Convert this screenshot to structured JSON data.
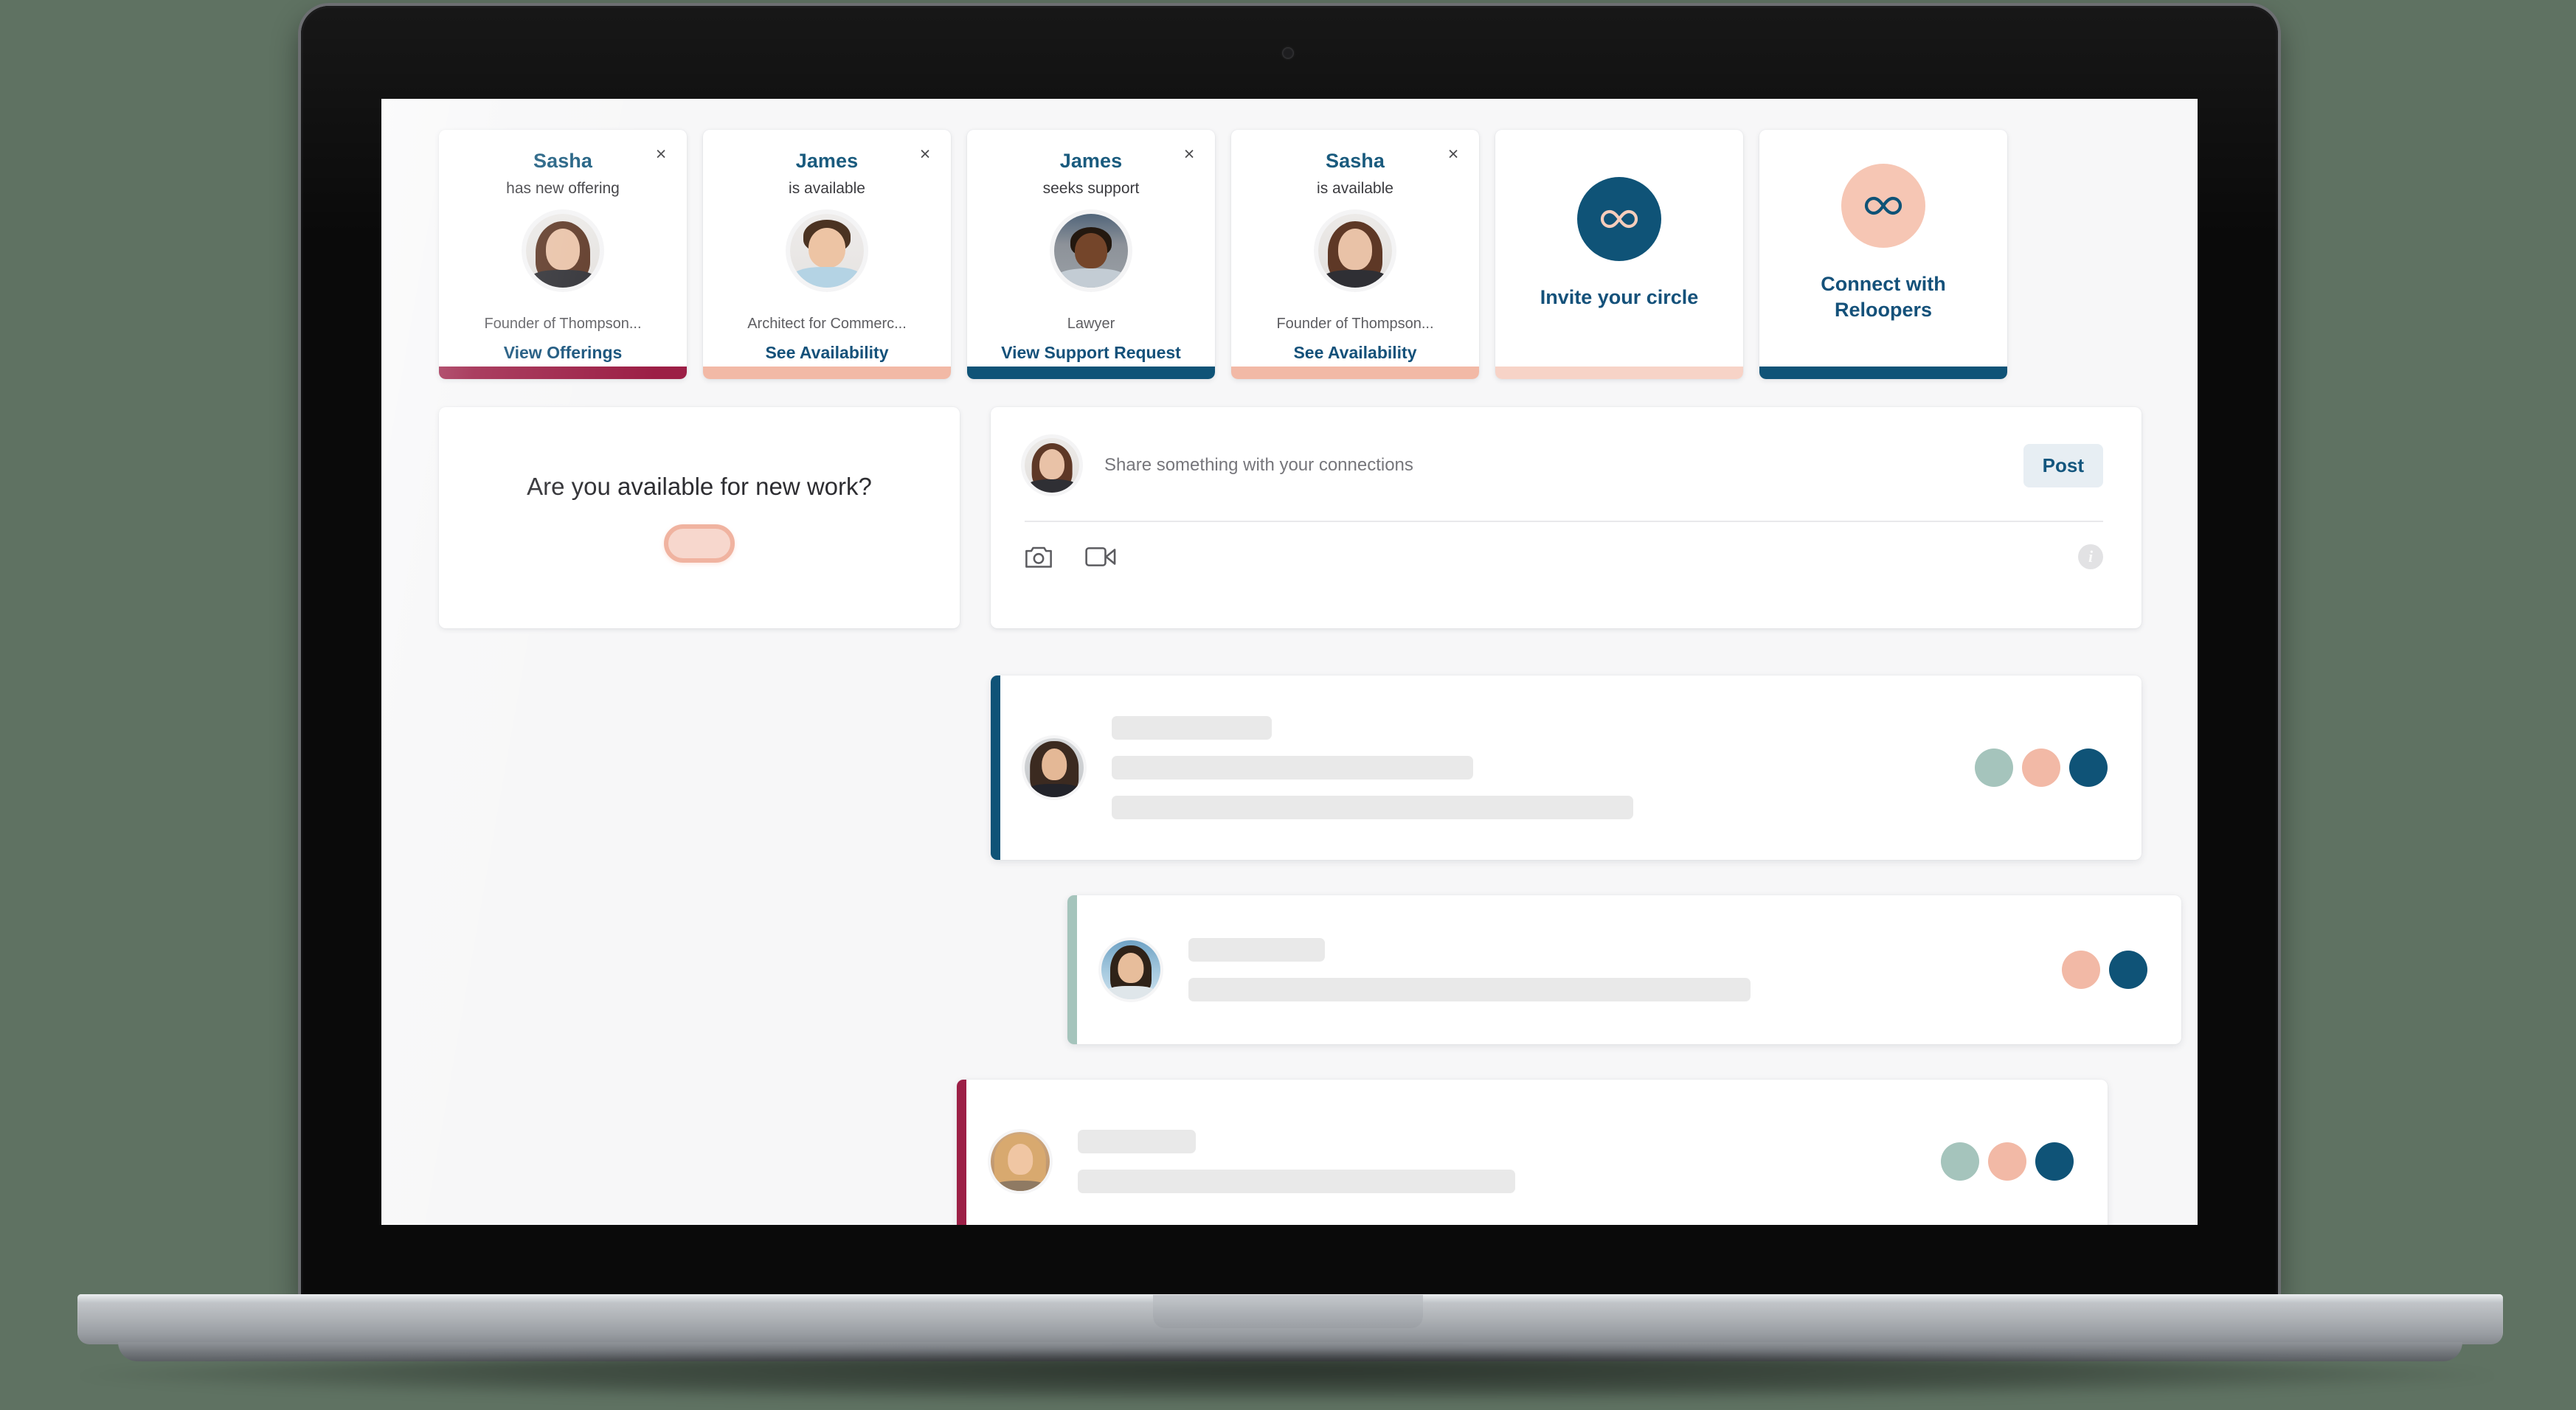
{
  "colors": {
    "navy": "#0f5377",
    "navy_text": "#14517a",
    "burgundy": "#9c1f46",
    "salmon": "#f2b9a6",
    "sage": "#a5c4bc",
    "screen_bg": "#f7f7f8",
    "post_button_bg": "#e7eef3",
    "toggle_fill": "#f7d7cd",
    "toggle_border": "#f0b3a0"
  },
  "notifications": [
    {
      "name": "Sasha",
      "status": "has new offering",
      "role": "Founder of Thompson...",
      "action": "View Offerings",
      "accent": "#9c1f46",
      "close_icon": "close-icon",
      "avatar": "av-sasha"
    },
    {
      "name": "James",
      "status": "is available",
      "role": "Architect for Commerc...",
      "action": "See Availability",
      "accent": "#f2b9a6",
      "close_icon": "close-icon",
      "avatar": "av-james"
    },
    {
      "name": "James",
      "status": "seeks support",
      "role": "Lawyer",
      "action": "View Support Request",
      "accent": "#0f5377",
      "close_icon": "close-icon",
      "avatar": "av-lawyer"
    },
    {
      "name": "Sasha",
      "status": "is available",
      "role": "Founder of Thompson...",
      "action": "See Availability",
      "accent": "#f2b9a6",
      "close_icon": "close-icon",
      "avatar": "av-sasha"
    }
  ],
  "cta_cards": [
    {
      "label": "Invite your circle",
      "badge_bg": "#0f5377",
      "badge_fg": "#f6cdbb",
      "accent": "#f7d3c7",
      "icon": "infinity-icon"
    },
    {
      "label": "Connect with Reloopers",
      "badge_bg": "#f6c6b4",
      "badge_fg": "#0f5377",
      "accent": "#0f5377",
      "icon": "infinity-icon"
    }
  ],
  "availability": {
    "question": "Are you available for new work?",
    "toggle_state": "off"
  },
  "composer": {
    "placeholder": "Share something with your connections",
    "value": "",
    "post_label": "Post",
    "avatar": "av-sasha",
    "tools": [
      {
        "name": "camera-icon"
      },
      {
        "name": "video-camera-icon"
      }
    ],
    "info_icon": "info-icon",
    "info_label": "i"
  },
  "feed": [
    {
      "bar_color": "#0f5377",
      "avatar": "av-brunette",
      "skeleton_widths": [
        "19%",
        "43%",
        "62%"
      ],
      "reactions": [
        "#a5c4bc",
        "#f2b9a6",
        "#0f5377"
      ]
    },
    {
      "bar_color": "#a5c4bc",
      "avatar": "av-sky",
      "skeleton_widths": [
        "16%",
        "66%"
      ],
      "reactions": [
        "#f2b9a6",
        "#0f5377"
      ]
    },
    {
      "bar_color": "#9c1f46",
      "avatar": "av-blonde",
      "skeleton_widths": [
        "14%",
        "52%"
      ],
      "reactions": [
        "#a5c4bc",
        "#f2b9a6",
        "#0f5377"
      ]
    }
  ]
}
